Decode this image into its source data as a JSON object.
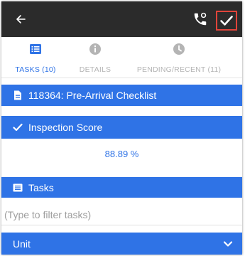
{
  "colors": {
    "accent": "#2f73e6",
    "topbar": "#2b2b2b",
    "highlight": "#e0443a",
    "inactive_tab": "#b4b4b4"
  },
  "topbar": {
    "back_icon": "arrow-left-icon",
    "call_icon": "phone-callback-icon",
    "confirm_icon": "check-icon"
  },
  "tabs": [
    {
      "label": "TASKS (10)",
      "icon": "list-icon",
      "active": true
    },
    {
      "label": "DETAILS",
      "icon": "info-icon",
      "active": false
    },
    {
      "label": "PENDING/RECENT (11)",
      "icon": "clock-icon",
      "active": false
    }
  ],
  "checklist": {
    "title": "118364: Pre-Arrival Checklist",
    "icon": "document-icon"
  },
  "inspection": {
    "label": "Inspection Score",
    "icon": "check-icon",
    "score": "88.89 %"
  },
  "tasks_section": {
    "label": "Tasks",
    "icon": "list-icon"
  },
  "filter": {
    "placeholder": "(Type to filter tasks)",
    "value": ""
  },
  "unit": {
    "label": "Unit",
    "icon": "chevron-down-icon"
  }
}
